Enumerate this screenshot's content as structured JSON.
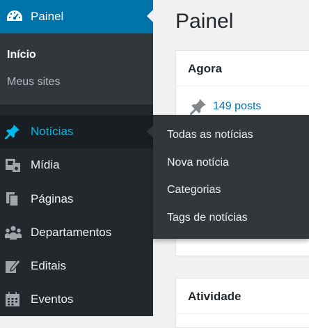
{
  "sidebar": {
    "dashboard_label": "Painel",
    "submenu": [
      "Início",
      "Meus sites"
    ],
    "items": [
      {
        "label": "Notícias",
        "icon": "pin-icon"
      },
      {
        "label": "Mídia",
        "icon": "media-icon"
      },
      {
        "label": "Páginas",
        "icon": "pages-icon"
      },
      {
        "label": "Departamentos",
        "icon": "groups-icon"
      },
      {
        "label": "Editais",
        "icon": "edit-icon"
      },
      {
        "label": "Eventos",
        "icon": "calendar-icon"
      }
    ]
  },
  "flyout": {
    "items": [
      "Todas as notícias",
      "Nova notícia",
      "Categorias",
      "Tags de notícias"
    ]
  },
  "main": {
    "title": "Painel",
    "at_a_glance": {
      "title": "Agora",
      "posts": "149 posts"
    },
    "activity": {
      "title": "Atividade"
    }
  },
  "colors": {
    "sidebar_bg": "#23282d",
    "active_blue": "#0073aa",
    "hover_text": "#00b9eb",
    "submenu_bg": "#32373c"
  }
}
